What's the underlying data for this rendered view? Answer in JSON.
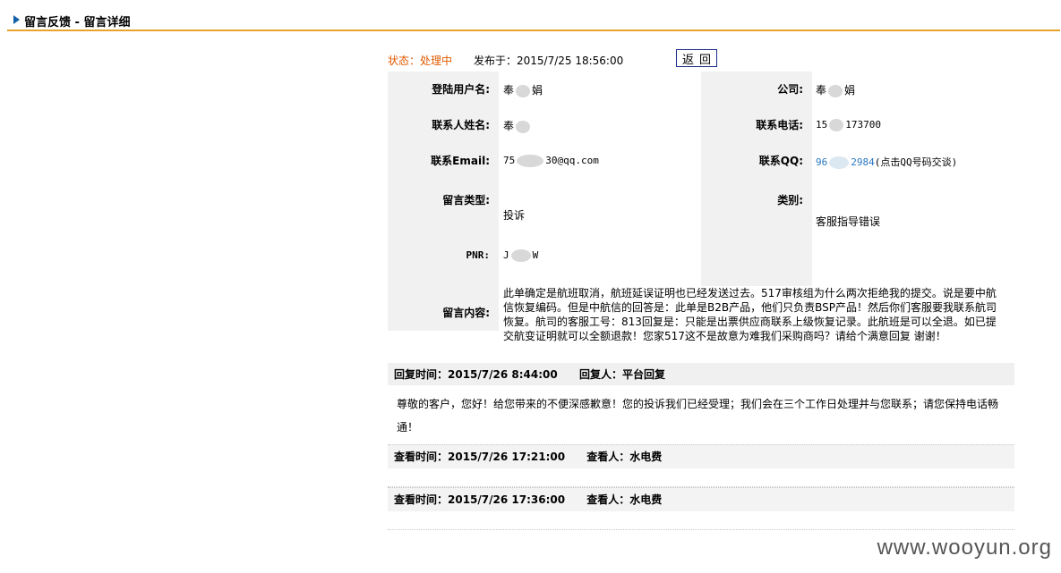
{
  "header": {
    "title": "留言反馈 - 留言详细"
  },
  "topline": {
    "status": "状态：处理中",
    "posted": "发布于：2015/7/25 18:56:00",
    "back_label": "返回"
  },
  "info": {
    "username_label": "登陆用户名:",
    "username_value_a": "奉",
    "username_value_b": "娟",
    "company_label": "公司:",
    "company_value_a": "奉",
    "company_value_b": "娟",
    "contact_name_label": "联系人姓名:",
    "contact_name_value": "奉",
    "phone_label": "联系电话:",
    "phone_value_a": "15",
    "phone_value_b": "173700",
    "email_label": "联系Email:",
    "email_value_a": "75",
    "email_value_b": "30@qq.com",
    "qq_label": "联系QQ:",
    "qq_value_a": "96",
    "qq_value_b": "2984",
    "qq_hint": "(点击QQ号码交谈)",
    "msg_type_label": "留言类型:",
    "msg_type_value": "投诉",
    "category_label": "类别:",
    "category_value": "客服指导错误",
    "pnr_label": "PNR:",
    "pnr_value_a": "J",
    "pnr_value_b": "W",
    "content_label": "留言内容:",
    "content_value": "此单确定是航班取消，航班延误证明也已经发送过去。517审核组为什么两次拒绝我的提交。说是要中航信恢复编码。但是中航信的回答是：此单是B2B产品，他们只负责BSP产品！然后你们客服要我联系航司恢复。航司的客服工号：813回复是：只能是出票供应商联系上级恢复记录。此航班是可以全退。如已提交航变证明就可以全额退款！您家517这不是故意为难我们采购商吗？请给个满意回复 谢谢！"
  },
  "reply": {
    "time": "回复时间：2015/7/26 8:44:00",
    "by": "回复人：平台回复",
    "body": "尊敬的客户，您好！给您带来的不便深感歉意！您的投诉我们已经受理；我们会在三个工作日处理并与您联系；请您保持电话畅通！"
  },
  "views": [
    {
      "time": "查看时间：2015/7/26 17:21:00",
      "by": "查看人：水电费"
    },
    {
      "time": "查看时间：2015/7/26 17:36:00",
      "by": "查看人：水电费"
    }
  ],
  "watermark": "www.wooyun.org"
}
